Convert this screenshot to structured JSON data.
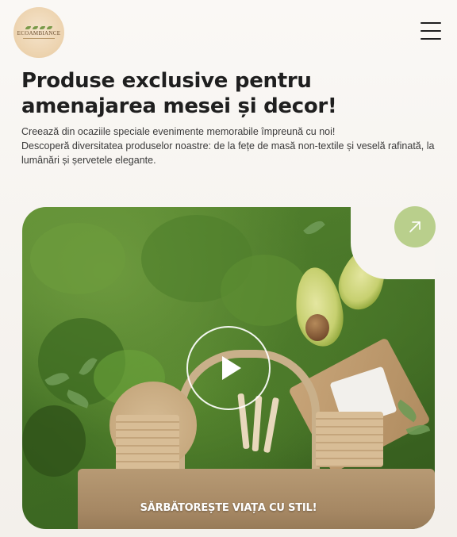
{
  "header": {
    "logo_text": "ECOAMBIANCE",
    "menu_icon": "hamburger-menu-icon"
  },
  "hero": {
    "title": "Produse exclusive pentru amenajarea mesei și decor!",
    "intro_line1": "Creează din ocaziile speciale evenimente memorabile împreună cu noi!",
    "intro_line2": "Descoperă diversitatea produselor noastre: de la fețe de masă non-textile și veselă rafinată, la lumânări și șervetele elegante.",
    "video_caption": "SĂRBĂTOREȘTE VIAȚA CU STIL!",
    "play_icon": "play-icon",
    "arrow_icon": "arrow-up-right-icon"
  },
  "colors": {
    "accent_green": "#b9cf8c",
    "logo_bg": "#ecd2ad",
    "text_dark": "#1f1f1f"
  }
}
